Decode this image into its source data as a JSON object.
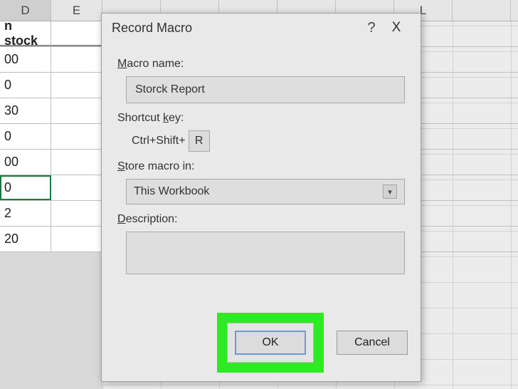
{
  "columns": {
    "d": "D",
    "e": "E",
    "l": "L"
  },
  "data_column_header": "n stock",
  "data_values": [
    "00",
    "0",
    "30",
    "0",
    "00",
    "0",
    "2",
    "20"
  ],
  "selected_row_index": 5,
  "dialog": {
    "title": "Record Macro",
    "help_symbol": "?",
    "close_symbol": "X",
    "macro_name_label_parts": {
      "ul": "M",
      "rest": "acro name:"
    },
    "macro_name_value": "Storck Report",
    "shortcut_label_parts": {
      "pre": "Shortcut ",
      "ul": "k",
      "post": "ey:"
    },
    "shortcut_prefix": "Ctrl+Shift+",
    "shortcut_key": "R",
    "store_label_parts": {
      "ul": "S",
      "rest": "tore macro in:"
    },
    "store_value": "This Workbook",
    "description_label_parts": {
      "ul": "D",
      "rest": "escription:"
    },
    "description_value": "",
    "ok_label": "OK",
    "cancel_label": "Cancel"
  }
}
